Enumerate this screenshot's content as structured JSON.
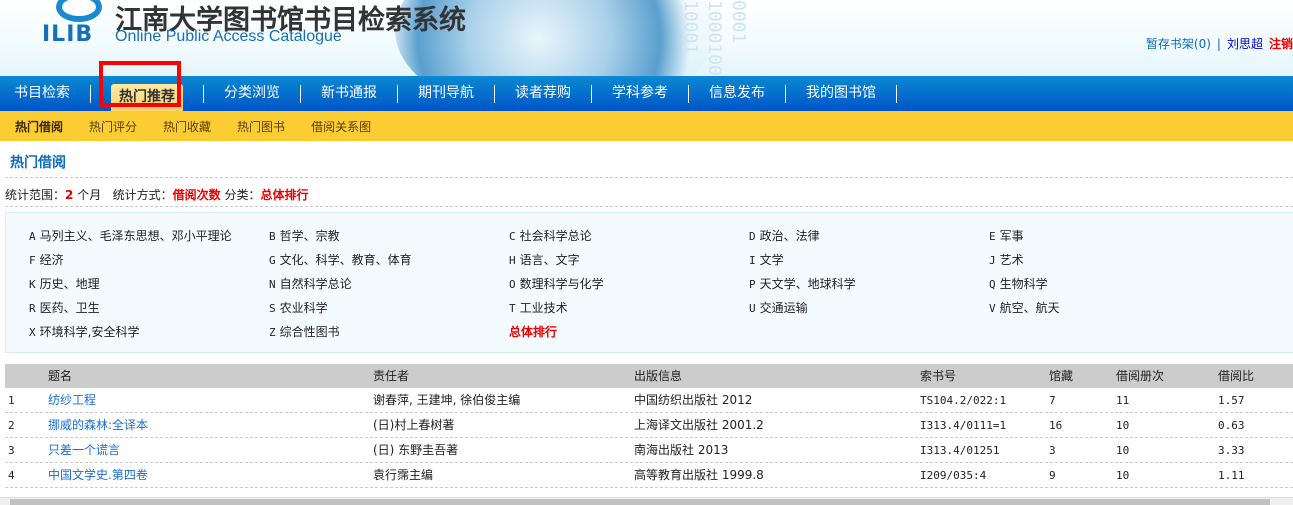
{
  "header": {
    "title": "江南大学图书馆书目检索系统",
    "subtitle": "Online Public Access Catalogue",
    "logo": "ILIB",
    "binary_decor": "0001 1000100 10001",
    "shelf": "暂存书架(0)",
    "sep": "|",
    "user": "刘思超",
    "logout": "注销"
  },
  "nav": [
    {
      "label": "书目检索"
    },
    {
      "label": "热门推荐",
      "active": true
    },
    {
      "label": "分类浏览"
    },
    {
      "label": "新书通报"
    },
    {
      "label": "期刊导航"
    },
    {
      "label": "读者荐购"
    },
    {
      "label": "学科参考"
    },
    {
      "label": "信息发布"
    },
    {
      "label": "我的图书馆"
    }
  ],
  "subnav": [
    {
      "label": "热门借阅",
      "active": true
    },
    {
      "label": "热门评分"
    },
    {
      "label": "热门收藏"
    },
    {
      "label": "热门图书"
    },
    {
      "label": "借阅关系图"
    }
  ],
  "page_title": "热门借阅",
  "stats": {
    "range_label": "统计范围：",
    "range_value": "2",
    "range_unit": " 个月",
    "method_label": "统计方式：",
    "method_value": "借阅次数",
    "cat_label": "分类：",
    "cat_value": "总体排行"
  },
  "categories": [
    {
      "code": "A",
      "name": "马列主义、毛泽东思想、邓小平理论"
    },
    {
      "code": "B",
      "name": "哲学、宗教"
    },
    {
      "code": "C",
      "name": "社会科学总论"
    },
    {
      "code": "D",
      "name": "政治、法律"
    },
    {
      "code": "E",
      "name": "军事"
    },
    {
      "code": "F",
      "name": "经济"
    },
    {
      "code": "G",
      "name": "文化、科学、教育、体育"
    },
    {
      "code": "H",
      "name": "语言、文字"
    },
    {
      "code": "I",
      "name": "文学"
    },
    {
      "code": "J",
      "name": "艺术"
    },
    {
      "code": "K",
      "name": "历史、地理"
    },
    {
      "code": "N",
      "name": "自然科学总论"
    },
    {
      "code": "O",
      "name": "数理科学与化学"
    },
    {
      "code": "P",
      "name": "天文学、地球科学"
    },
    {
      "code": "Q",
      "name": "生物科学"
    },
    {
      "code": "R",
      "name": "医药、卫生"
    },
    {
      "code": "S",
      "name": "农业科学"
    },
    {
      "code": "T",
      "name": "工业技术"
    },
    {
      "code": "U",
      "name": "交通运输"
    },
    {
      "code": "V",
      "name": "航空、航天"
    },
    {
      "code": "X",
      "name": "环境科学,安全科学"
    },
    {
      "code": "Z",
      "name": "综合性图书"
    },
    {
      "code": "",
      "name": "总体排行",
      "active": true
    }
  ],
  "table": {
    "headers": [
      "题名",
      "责任者",
      "出版信息",
      "索书号",
      "馆藏",
      "借阅册次",
      "借阅比"
    ],
    "rows": [
      {
        "no": "1",
        "title": "纺纱工程",
        "author": "谢春萍, 王建坤, 徐伯俊主编",
        "pub": "中国纺织出版社 2012",
        "call": "TS104.2/022:1",
        "holdings": "7",
        "loans": "11",
        "ratio": "1.57"
      },
      {
        "no": "2",
        "title": "挪威的森林:全译本",
        "author": "(日)村上春树著",
        "pub": "上海译文出版社 2001.2",
        "call": "I313.4/0111=1",
        "holdings": "16",
        "loans": "10",
        "ratio": "0.63"
      },
      {
        "no": "3",
        "title": "只差一个谎言",
        "author": "(日) 东野圭吾著",
        "pub": "南海出版社 2013",
        "call": "I313.4/01251",
        "holdings": "3",
        "loans": "10",
        "ratio": "3.33"
      },
      {
        "no": "4",
        "title": "中国文学史.第四卷",
        "author": "袁行霈主编",
        "pub": "高等教育出版社 1999.8",
        "call": "I209/035:4",
        "holdings": "9",
        "loans": "10",
        "ratio": "1.11"
      }
    ]
  }
}
